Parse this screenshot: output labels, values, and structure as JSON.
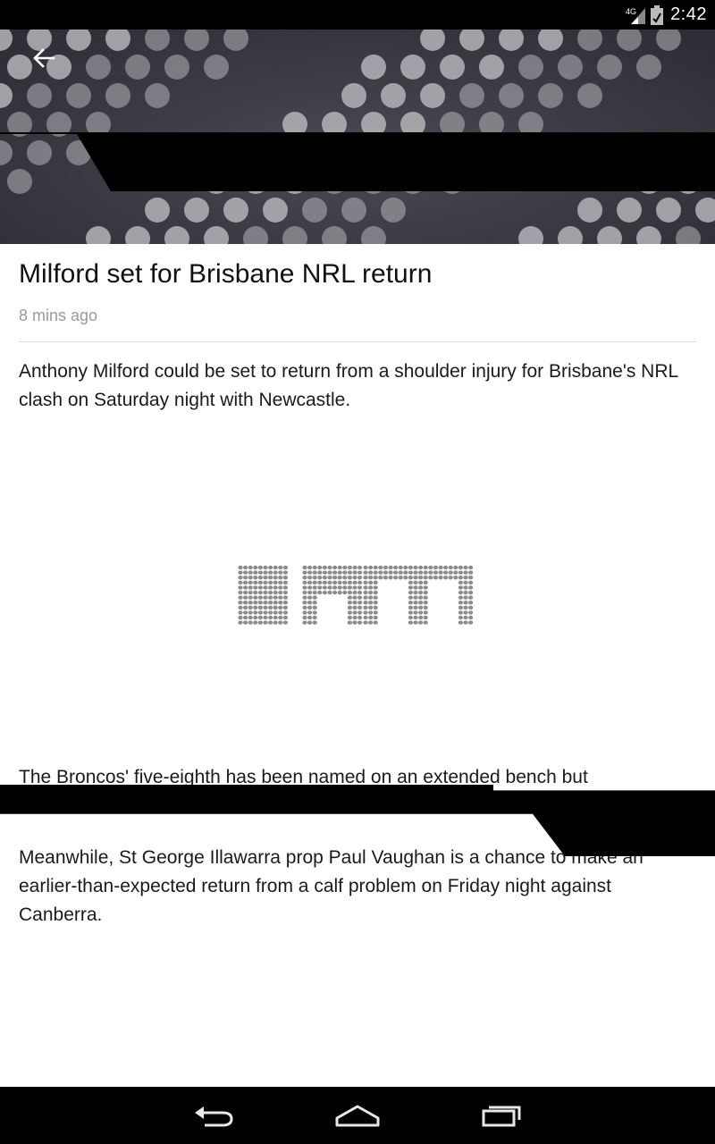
{
  "status_bar": {
    "network_label": "4G",
    "time": "2:42"
  },
  "header": {
    "back_icon": "arrow-back-icon"
  },
  "article": {
    "title": "Milford set for Brisbane NRL return",
    "timestamp": "8 mins ago",
    "paragraphs": [
      "Anthony Milford could be set to return from a shoulder injury for Brisbane's NRL clash on Saturday night with Newcastle.",
      "The Broncos' five-eighth has been named on an extended bench but",
      "Meanwhile, St George Illawarra prop Paul Vaughan is a chance to make an earlier-than-expected return from a calf problem on Friday night against Canberra."
    ],
    "logo_text": "ism"
  },
  "nav_bar": {
    "back_icon": "nav-back-icon",
    "home_icon": "nav-home-icon",
    "recents_icon": "nav-recents-icon"
  },
  "colors": {
    "status_bar_bg": "#000000",
    "title_text": "#111111",
    "timestamp_text": "#9a9a9a",
    "header_dot": "#b4b4b8"
  }
}
